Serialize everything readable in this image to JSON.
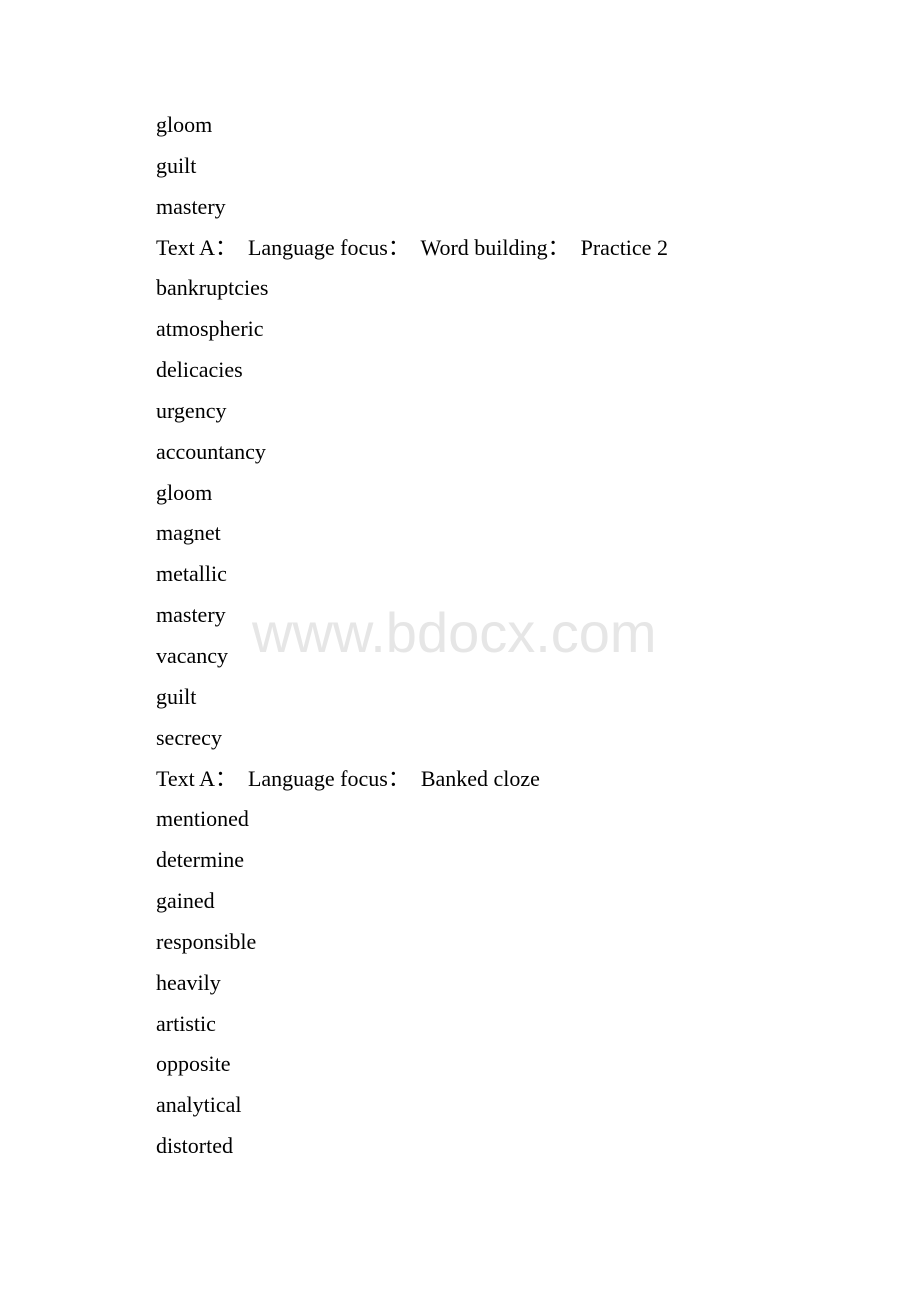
{
  "watermark": "www.bdocx.com",
  "lines": [
    {
      "type": "word",
      "text": "gloom"
    },
    {
      "type": "word",
      "text": "guilt"
    },
    {
      "type": "word",
      "text": "mastery"
    },
    {
      "type": "heading",
      "text": "Text A：  Language focus：  Word building：  Practice 2"
    },
    {
      "type": "word",
      "text": "bankruptcies"
    },
    {
      "type": "word",
      "text": "atmospheric"
    },
    {
      "type": "word",
      "text": "delicacies"
    },
    {
      "type": "word",
      "text": "urgency"
    },
    {
      "type": "word",
      "text": "accountancy"
    },
    {
      "type": "word",
      "text": "gloom"
    },
    {
      "type": "word",
      "text": "magnet"
    },
    {
      "type": "word",
      "text": "metallic"
    },
    {
      "type": "word",
      "text": "mastery"
    },
    {
      "type": "word",
      "text": "vacancy"
    },
    {
      "type": "word",
      "text": "guilt"
    },
    {
      "type": "word",
      "text": "secrecy"
    },
    {
      "type": "heading",
      "text": "Text A：  Language focus：  Banked cloze"
    },
    {
      "type": "word",
      "text": "mentioned"
    },
    {
      "type": "word",
      "text": "determine"
    },
    {
      "type": "word",
      "text": "gained"
    },
    {
      "type": "word",
      "text": "responsible"
    },
    {
      "type": "word",
      "text": "heavily"
    },
    {
      "type": "word",
      "text": "artistic"
    },
    {
      "type": "word",
      "text": "opposite"
    },
    {
      "type": "word",
      "text": "analytical"
    },
    {
      "type": "word",
      "text": "distorted"
    }
  ]
}
